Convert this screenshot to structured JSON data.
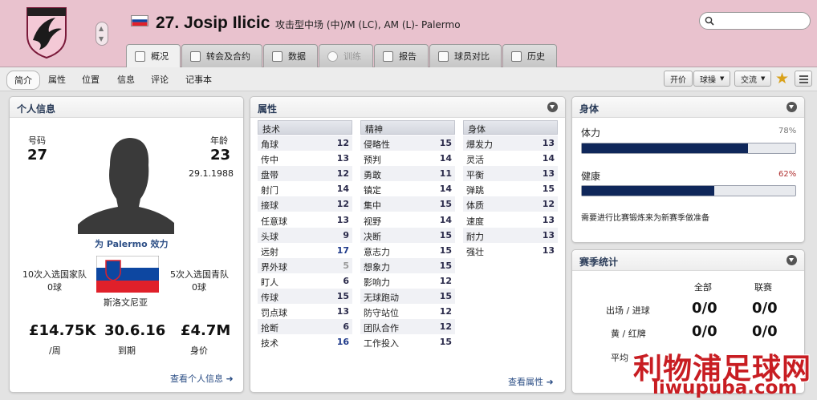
{
  "header": {
    "player_name": "27. Josip Ilicic",
    "player_role": "攻击型中场 (中)/M (LC), AM (L)- Palermo",
    "crest_text": "US CITTA DI PALERMO"
  },
  "tabs": [
    {
      "label": "概况",
      "active": true
    },
    {
      "label": "转会及合约"
    },
    {
      "label": "数据"
    },
    {
      "label": "训练",
      "disabled": true
    },
    {
      "label": "报告"
    },
    {
      "label": "球员对比"
    },
    {
      "label": "历史"
    }
  ],
  "subnav": {
    "items": [
      "简介",
      "属性",
      "位置",
      "信息",
      "评论",
      "记事本"
    ],
    "buttons": {
      "offer": "开价",
      "tactics": "球操",
      "interact": "交流"
    }
  },
  "personal": {
    "title": "个人信息",
    "number_label": "号码",
    "number": "27",
    "age_label": "年龄",
    "age": "23",
    "dob": "29.1.1988",
    "plays_for": "为 Palermo 效力",
    "national_caps_label": "10次入选国家队",
    "national_goals": "0球",
    "youth_caps_label": "5次入选国青队",
    "youth_goals": "0球",
    "nationality": "斯洛文尼亚",
    "wage": "£14.75K",
    "wage_label": "/周",
    "expires": "30.6.16",
    "expires_label": "到期",
    "value": "£4.7M",
    "value_label": "身价",
    "link": "查看个人信息"
  },
  "attributes": {
    "title": "属性",
    "technical": {
      "header": "技术",
      "rows": [
        {
          "name": "角球",
          "value": "12"
        },
        {
          "name": "传中",
          "value": "13"
        },
        {
          "name": "盘带",
          "value": "12"
        },
        {
          "name": "射门",
          "value": "14"
        },
        {
          "name": "接球",
          "value": "12"
        },
        {
          "name": "任意球",
          "value": "13"
        },
        {
          "name": "头球",
          "value": "9"
        },
        {
          "name": "远射",
          "value": "17"
        },
        {
          "name": "界外球",
          "value": "5"
        },
        {
          "name": "盯人",
          "value": "6"
        },
        {
          "name": "传球",
          "value": "15"
        },
        {
          "name": "罚点球",
          "value": "13"
        },
        {
          "name": "抢断",
          "value": "6"
        },
        {
          "name": "技术",
          "value": "16"
        }
      ]
    },
    "mental": {
      "header": "精神",
      "rows": [
        {
          "name": "侵略性",
          "value": "15"
        },
        {
          "name": "预判",
          "value": "14"
        },
        {
          "name": "勇敢",
          "value": "11"
        },
        {
          "name": "镇定",
          "value": "14"
        },
        {
          "name": "集中",
          "value": "15"
        },
        {
          "name": "视野",
          "value": "14"
        },
        {
          "name": "决断",
          "value": "15"
        },
        {
          "name": "意志力",
          "value": "15"
        },
        {
          "name": "想象力",
          "value": "15"
        },
        {
          "name": "影响力",
          "value": "12"
        },
        {
          "name": "无球跑动",
          "value": "15"
        },
        {
          "name": "防守站位",
          "value": "12"
        },
        {
          "name": "团队合作",
          "value": "12"
        },
        {
          "name": "工作投入",
          "value": "15"
        }
      ]
    },
    "physical": {
      "header": "身体",
      "rows": [
        {
          "name": "爆发力",
          "value": "13"
        },
        {
          "name": "灵活",
          "value": "14"
        },
        {
          "name": "平衡",
          "value": "13"
        },
        {
          "name": "弹跳",
          "value": "15"
        },
        {
          "name": "体质",
          "value": "12"
        },
        {
          "name": "速度",
          "value": "13"
        },
        {
          "name": "耐力",
          "value": "13"
        },
        {
          "name": "强壮",
          "value": "13"
        }
      ]
    },
    "link": "查看属性"
  },
  "body": {
    "title": "身体",
    "fitness_label": "体力",
    "fitness_pct": "78%",
    "fitness_value": 78,
    "health_label": "健康",
    "health_pct": "62%",
    "health_value": 62,
    "note": "需要进行比赛锻炼来为新赛季做准备"
  },
  "season": {
    "title": "赛季统计",
    "col_all": "全部",
    "col_league": "联赛",
    "rows": [
      {
        "label": "出场 / 进球",
        "all": "0/0",
        "league": "0/0"
      },
      {
        "label": "黄 / 红牌",
        "all": "0/0",
        "league": "0/0"
      },
      {
        "label": "平均"
      }
    ]
  },
  "watermark": {
    "text": "利物浦足球网",
    "url": "liwupuba.com"
  },
  "colors": {
    "header_bg": "#e9c2ce",
    "bar_fill": "#0f275a",
    "accent_blue": "#283a57",
    "watermark_red": "#c81d22"
  }
}
